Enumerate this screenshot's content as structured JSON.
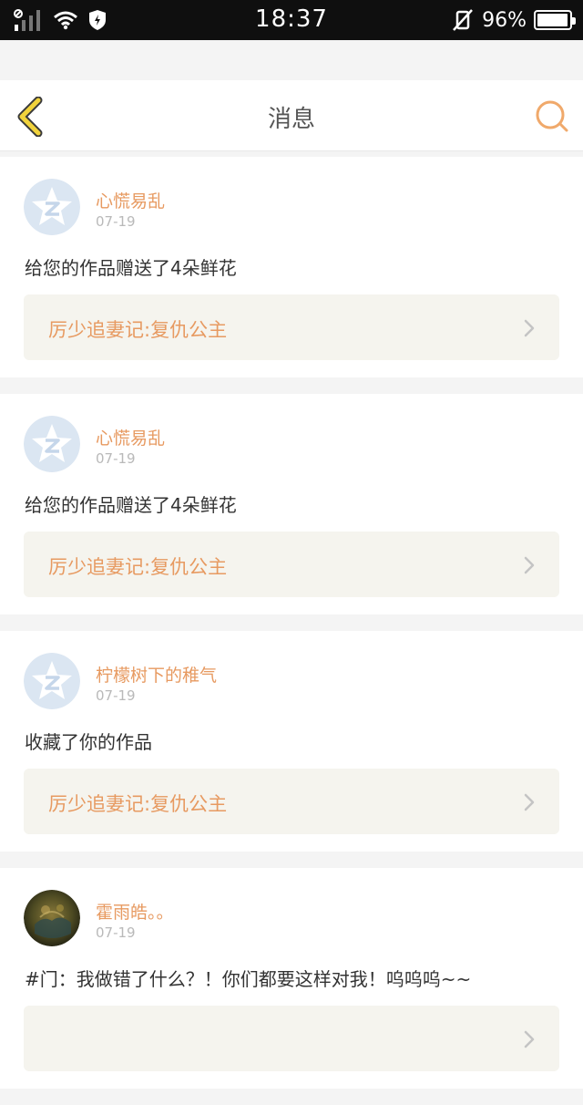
{
  "status_bar": {
    "time": "18:37",
    "battery": "96%",
    "battery_level": 0.96
  },
  "header": {
    "title": "消息",
    "back_icon": "chevron-left-icon",
    "search_icon": "search-icon"
  },
  "colors": {
    "accent": "#e79a61",
    "back_yellow": "#f1d33c",
    "link_bg": "#f5f4ee"
  },
  "messages": [
    {
      "username": "心慌易乱",
      "date": "07-19",
      "text": "给您的作品赠送了4朵鲜花",
      "work": "厉少追妻记:复仇公主",
      "avatar": "default-qzone-avatar"
    },
    {
      "username": "心慌易乱",
      "date": "07-19",
      "text": "给您的作品赠送了4朵鲜花",
      "work": "厉少追妻记:复仇公主",
      "avatar": "default-qzone-avatar"
    },
    {
      "username": "柠檬树下的稚气",
      "date": "07-19",
      "text": "收藏了你的作品",
      "work": "厉少追妻记:复仇公主",
      "avatar": "default-qzone-avatar"
    },
    {
      "username": "霍雨皓。。",
      "date": "07-19",
      "text": "#门：我做错了什么？！你们都要这样对我！呜呜呜~~",
      "work": "",
      "avatar": "photo-avatar"
    }
  ]
}
